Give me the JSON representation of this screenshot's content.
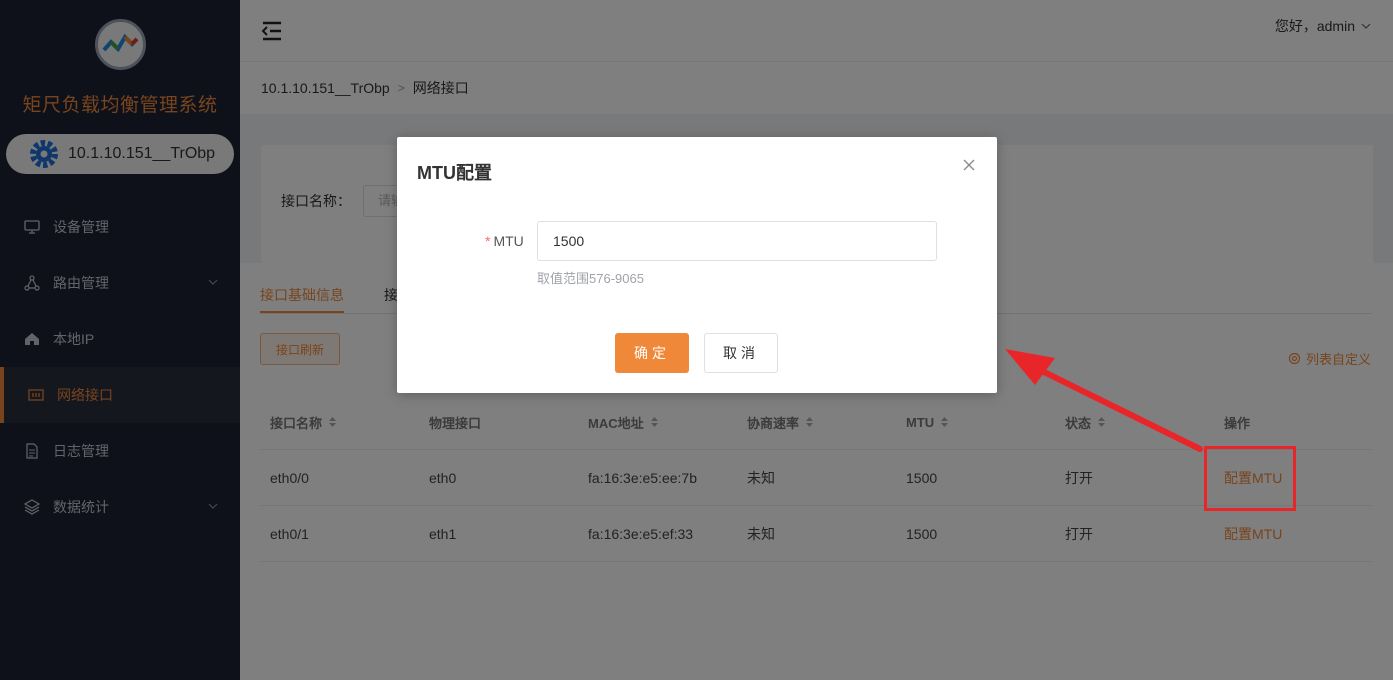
{
  "sidebar": {
    "system_title": "矩尺负载均衡管理系统",
    "device_label": "10.1.10.151__TrObp",
    "items": [
      {
        "label": "设备管理",
        "icon": "monitor-icon"
      },
      {
        "label": "路由管理",
        "icon": "network-icon"
      },
      {
        "label": "本地IP",
        "icon": "home-icon"
      },
      {
        "label": "网络接口",
        "icon": "interface-icon"
      },
      {
        "label": "日志管理",
        "icon": "document-icon"
      },
      {
        "label": "数据统计",
        "icon": "layers-icon"
      }
    ]
  },
  "header": {
    "greeting": "您好，admin"
  },
  "breadcrumb": {
    "device": "10.1.10.151__TrObp",
    "page": "网络接口"
  },
  "filter": {
    "label": "接口名称：",
    "placeholder": "请输"
  },
  "tabs": [
    {
      "label": "接口基础信息"
    },
    {
      "label": "接"
    }
  ],
  "toolbar": {
    "refresh_label": "接口刷新",
    "customize_label": "列表自定义"
  },
  "table": {
    "headers": [
      "接口名称",
      "物理接口",
      "MAC地址",
      "协商速率",
      "MTU",
      "状态",
      "操作"
    ],
    "rows": [
      {
        "name": "eth0/0",
        "physical": "eth0",
        "mac": "fa:16:3e:e5:ee:7b",
        "speed": "未知",
        "mtu": "1500",
        "status": "打开",
        "action": "配置MTU"
      },
      {
        "name": "eth0/1",
        "physical": "eth1",
        "mac": "fa:16:3e:e5:ef:33",
        "speed": "未知",
        "mtu": "1500",
        "status": "打开",
        "action": "配置MTU"
      }
    ]
  },
  "modal": {
    "title": "MTU配置",
    "field_required_mark": "*",
    "field_label": "MTU",
    "field_value": "1500",
    "hint": "取值范围576-9065",
    "ok_label": "确定",
    "cancel_label": "取消"
  },
  "colors": {
    "accent": "#f0883a",
    "sidebar_bg": "#1e2335",
    "annotation_red": "#e8262a"
  }
}
